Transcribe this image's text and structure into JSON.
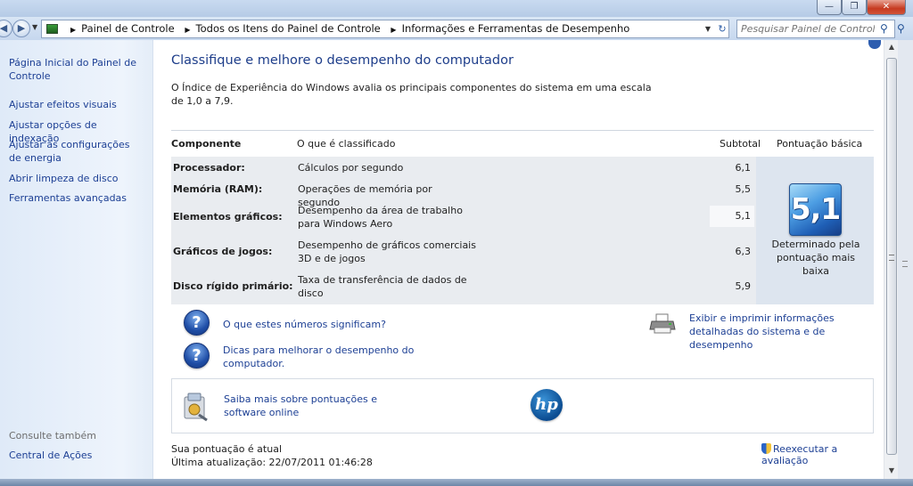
{
  "window": {
    "min_glyph": "—",
    "max_glyph": "❐",
    "close_glyph": "✕"
  },
  "address": {
    "crumbs": [
      "Painel de Controle",
      "Todos os Itens do Painel de Controle",
      "Informações e Ferramentas de Desempenho"
    ],
    "search_placeholder": "Pesquisar Painel de Controle"
  },
  "sidebar": {
    "home": "Página Inicial do Painel de Controle",
    "links": [
      "Ajustar efeitos visuais",
      "Ajustar opções de indexação",
      "Ajustar as configurações de energia",
      "Abrir limpeza de disco",
      "Ferramentas avançadas"
    ],
    "see_also_label": "Consulte também",
    "see_also_link": "Central de Ações"
  },
  "main": {
    "title": "Classifique e melhore o desempenho do computador",
    "intro": "O Índice de Experiência do Windows avalia os principais componentes do sistema em uma escala de 1,0 a 7,9.",
    "table": {
      "headers": {
        "component": "Componente",
        "rated": "O que é classificado",
        "subtotal": "Subtotal",
        "base": "Pontuação básica"
      },
      "rows": [
        {
          "name": "Processador:",
          "desc": "Cálculos por segundo",
          "subtotal": "6,1"
        },
        {
          "name": "Memória (RAM):",
          "desc": "Operações de memória por segundo",
          "subtotal": "5,5"
        },
        {
          "name": "Elementos gráficos:",
          "desc": "Desempenho da área de trabalho para Windows Aero",
          "subtotal": "5,1"
        },
        {
          "name": "Gráficos de jogos:",
          "desc": "Desempenho de gráficos comerciais 3D e de jogos",
          "subtotal": "6,3"
        },
        {
          "name": "Disco rígido primário:",
          "desc": "Taxa de transferência de dados de disco",
          "subtotal": "5,9"
        }
      ],
      "base_score": "5,1",
      "base_caption": "Determinado pela pontuação mais baixa"
    },
    "links": {
      "what_numbers": "O que estes números significam?",
      "tips": "Dicas para melhorar o desempenho do computador.",
      "print": "Exibir e imprimir informações detalhadas do sistema e de desempenho",
      "learn_more": "Saiba mais sobre pontuações e software online"
    },
    "hp_logo_text": "hp",
    "status": "Sua pontuação é atual",
    "last_update": "Última atualização: 22/07/2011 01:46:28",
    "rerun": "Reexecutar a avaliação"
  },
  "icons": {
    "help": "?",
    "back": "◀",
    "forward": "▶",
    "search": "⚲",
    "scroll_up": "▲",
    "scroll_down": "▼"
  }
}
